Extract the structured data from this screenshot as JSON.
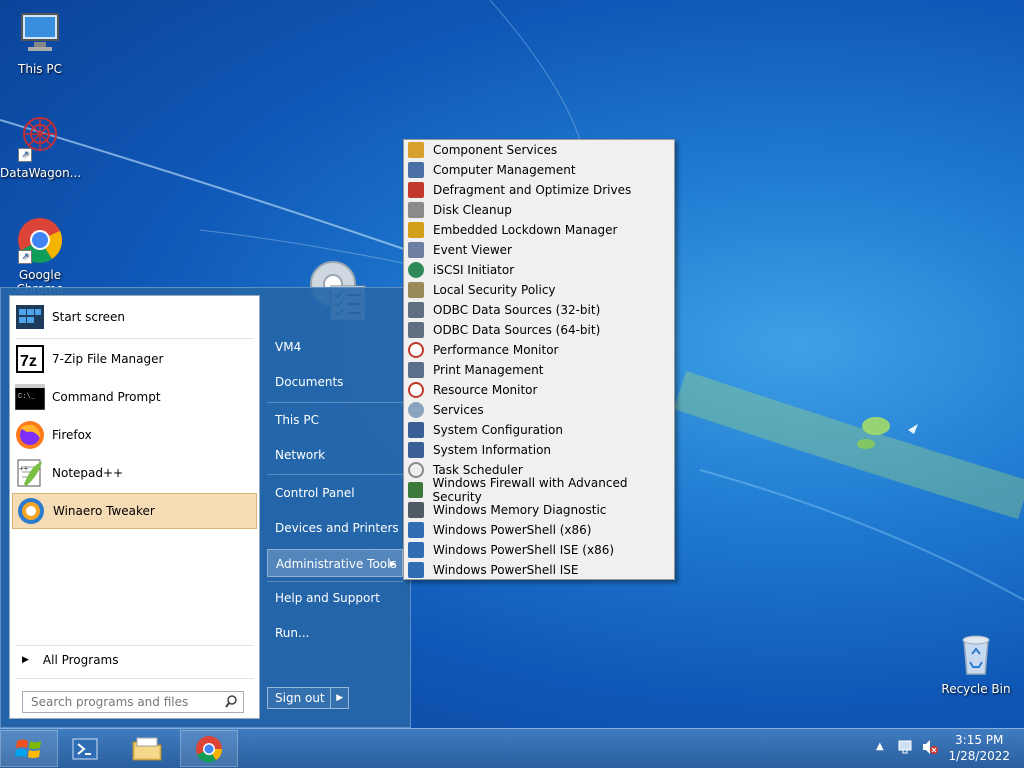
{
  "desktop": {
    "icons": [
      {
        "label": "This PC",
        "icon": "computer-icon"
      },
      {
        "label": "DataWagon...",
        "icon": "datawagon-icon"
      },
      {
        "label": "Google Chrome",
        "icon": "chrome-icon"
      },
      {
        "label": "Recycle Bin",
        "icon": "recycle-bin-icon"
      }
    ]
  },
  "start_menu": {
    "programs": [
      {
        "label": "Start screen",
        "icon": "start-screen-icon"
      },
      {
        "label": "7-Zip File Manager",
        "icon": "7zip-icon"
      },
      {
        "label": "Command Prompt",
        "icon": "command-prompt-icon"
      },
      {
        "label": "Firefox",
        "icon": "firefox-icon"
      },
      {
        "label": "Notepad++",
        "icon": "notepad-plus-plus-icon"
      },
      {
        "label": "Winaero Tweaker",
        "icon": "winaero-tweaker-icon"
      }
    ],
    "all_programs": "All Programs",
    "search_placeholder": "Search programs and files",
    "right_items": [
      {
        "label": "VM4"
      },
      {
        "label": "Documents"
      },
      {
        "label": "This PC"
      },
      {
        "label": "Network"
      },
      {
        "label": "Control Panel"
      },
      {
        "label": "Devices and Printers"
      },
      {
        "label": "Administrative Tools"
      },
      {
        "label": "Help and Support"
      },
      {
        "label": "Run..."
      }
    ],
    "sign_out": "Sign out",
    "highlighted_program": "Winaero Tweaker",
    "highlighted_right_item": "Administrative Tools"
  },
  "admin_tools": {
    "items": [
      {
        "label": "Component Services",
        "icon": "component-services-icon",
        "color": "#d9a12b"
      },
      {
        "label": "Computer Management",
        "icon": "computer-management-icon",
        "color": "#4a6fa5"
      },
      {
        "label": "Defragment and Optimize Drives",
        "icon": "defragment-icon",
        "color": "#c0392b"
      },
      {
        "label": "Disk Cleanup",
        "icon": "disk-cleanup-icon",
        "color": "#8a8a8a"
      },
      {
        "label": "Embedded Lockdown Manager",
        "icon": "lock-icon",
        "color": "#d4a017"
      },
      {
        "label": "Event Viewer",
        "icon": "event-viewer-icon",
        "color": "#6c7fa0"
      },
      {
        "label": "iSCSI Initiator",
        "icon": "globe-icon",
        "color": "#2e8b57"
      },
      {
        "label": "Local Security Policy",
        "icon": "security-policy-icon",
        "color": "#9a8a5a"
      },
      {
        "label": "ODBC Data Sources (32-bit)",
        "icon": "odbc-icon",
        "color": "#607080"
      },
      {
        "label": "ODBC Data Sources (64-bit)",
        "icon": "odbc-icon",
        "color": "#607080"
      },
      {
        "label": "Performance Monitor",
        "icon": "performance-monitor-icon",
        "color": "#c0392b"
      },
      {
        "label": "Print Management",
        "icon": "printer-icon",
        "color": "#5a6f8a"
      },
      {
        "label": "Resource Monitor",
        "icon": "resource-monitor-icon",
        "color": "#c0392b"
      },
      {
        "label": "Services",
        "icon": "gear-icon",
        "color": "#8aa4c0"
      },
      {
        "label": "System Configuration",
        "icon": "system-configuration-icon",
        "color": "#3a5f95"
      },
      {
        "label": "System Information",
        "icon": "system-information-icon",
        "color": "#3a5f95"
      },
      {
        "label": "Task Scheduler",
        "icon": "clock-icon",
        "color": "#8c8c8c"
      },
      {
        "label": "Windows Firewall with Advanced Security",
        "icon": "firewall-icon",
        "color": "#3c7a3c"
      },
      {
        "label": "Windows Memory Diagnostic",
        "icon": "memory-diagnostic-icon",
        "color": "#505a64"
      },
      {
        "label": "Windows PowerShell (x86)",
        "icon": "powershell-icon",
        "color": "#2f6db5"
      },
      {
        "label": "Windows PowerShell ISE (x86)",
        "icon": "powershell-ise-icon",
        "color": "#2f6db5"
      },
      {
        "label": "Windows PowerShell ISE",
        "icon": "powershell-ise-icon",
        "color": "#2f6db5"
      }
    ]
  },
  "taskbar": {
    "pinned": [
      {
        "icon": "powershell-icon"
      },
      {
        "icon": "file-explorer-icon"
      },
      {
        "icon": "chrome-icon"
      }
    ],
    "time": "3:15 PM",
    "date": "1/28/2022"
  },
  "colors": {
    "desktop": "#1f7ad0",
    "start_menu": "#2666a8",
    "highlight": "#f5dcb5",
    "taskbar": "#3570b0"
  }
}
